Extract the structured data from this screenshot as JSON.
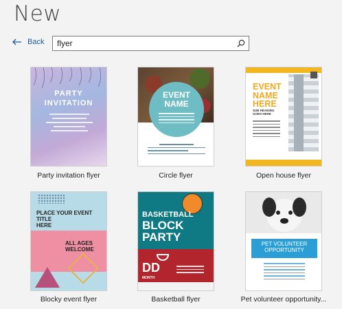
{
  "header": {
    "title": "New"
  },
  "nav": {
    "back_label": "Back"
  },
  "search": {
    "value": "flyer"
  },
  "templates": [
    {
      "label": "Party invitation flyer",
      "art_line1": "PARTY",
      "art_line2": "INVITATION"
    },
    {
      "label": "Circle flyer",
      "art_line1": "EVENT",
      "art_line2": "NAME"
    },
    {
      "label": "Open house flyer",
      "art_line1": "EVENT",
      "art_line2": "NAME",
      "art_line3": "HERE",
      "art_line4": "SUB HEADING",
      "art_line5": "GOES HERE"
    },
    {
      "label": "Blocky event flyer",
      "art_line1": "PLACE YOUR EVENT TITLE",
      "art_line2": "HERE",
      "art_line3": "ALL AGES",
      "art_line4": "WELCOME"
    },
    {
      "label": "Basketball flyer",
      "art_line1": "BASKETBALL",
      "art_line2": "BLOCK",
      "art_line3": "PARTY",
      "art_line4": "DD",
      "art_line5": "MONTH"
    },
    {
      "label": "Pet volunteer opportunity...",
      "art_line1": "PET VOLUNTEER",
      "art_line2": "OPPORTUNITY"
    }
  ],
  "colors": {
    "link": "#1a5a9a",
    "accent_yellow": "#f2b61f",
    "teal": "#0f7a83",
    "red": "#b3252d"
  },
  "icons": [
    "back-arrow-icon",
    "search-icon"
  ]
}
